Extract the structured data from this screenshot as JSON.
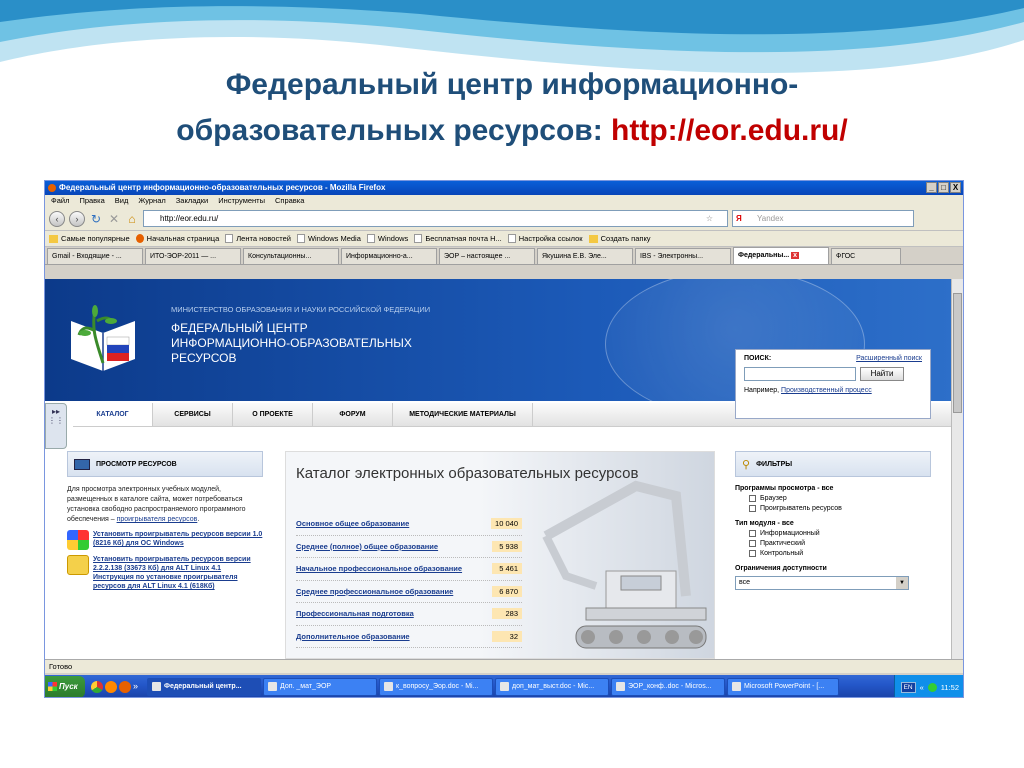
{
  "slide": {
    "title_line1": "Федеральный центр информационно-",
    "title_line2": "образовательных ресурсов: ",
    "title_url": "http://eor.edu.ru/"
  },
  "window": {
    "title": "Федеральный центр информационно-образовательных ресурсов - Mozilla Firefox",
    "controls": [
      "_",
      "□",
      "X"
    ]
  },
  "menubar": [
    "Файл",
    "Правка",
    "Вид",
    "Журнал",
    "Закладки",
    "Инструменты",
    "Справка"
  ],
  "navbar": {
    "url": "http://eor.edu.ru/",
    "search_engine": "Я",
    "search_placeholder": "Yandex"
  },
  "bookmarks": [
    {
      "label": "Самые популярные",
      "icon": "folder-icon"
    },
    {
      "label": "Начальная страница",
      "icon": "firefox-icon"
    },
    {
      "label": "Лента новостей",
      "icon": "page-icon"
    },
    {
      "label": "Windows Media",
      "icon": "page-icon"
    },
    {
      "label": "Windows",
      "icon": "page-icon"
    },
    {
      "label": "Бесплатная почта H...",
      "icon": "page-icon"
    },
    {
      "label": "Настройка ссылок",
      "icon": "page-icon"
    },
    {
      "label": "Создать папку",
      "icon": "folder-icon"
    }
  ],
  "tabs": [
    {
      "label": "Gmail - Входящие - ...",
      "active": false
    },
    {
      "label": "ИТО-ЭОР-2011 — ...",
      "active": false
    },
    {
      "label": "Консультационны...",
      "active": false
    },
    {
      "label": "Информационно-а...",
      "active": false
    },
    {
      "label": "ЭОР – настоящее ...",
      "active": false
    },
    {
      "label": "Якушина Е.В. Эле...",
      "active": false
    },
    {
      "label": "IBS - Электронны...",
      "active": false
    },
    {
      "label": "Федеральны...",
      "active": true
    },
    {
      "label": "ФГОС",
      "active": false
    }
  ],
  "site": {
    "ministry": "МИНИСТЕРСТВО ОБРАЗОВАНИЯ И НАУКИ РОССИЙСКОЙ ФЕДЕРАЦИИ",
    "org_line1": "ФЕДЕРАЛЬНЫЙ ЦЕНТР",
    "org_line2": "ИНФОРМАЦИОННО-ОБРАЗОВАТЕЛЬНЫХ",
    "org_line3": "РЕСУРСОВ",
    "menu": [
      "КАТАЛОГ",
      "СЕРВИСЫ",
      "О ПРОЕКТЕ",
      "ФОРУМ",
      "МЕТОДИЧЕСКИЕ МАТЕРИАЛЫ"
    ],
    "search": {
      "label": "ПОИСК:",
      "advanced": "Расширенный поиск",
      "button": "Найти",
      "example_prefix": "Например, ",
      "example_link": "Производственный процесс"
    },
    "viewer": {
      "title": "ПРОСМОТР РЕСУРСОВ",
      "text": "Для просмотра электронных учебных модулей, размещенных в каталоге сайта, может потребоваться установка свободно распространяемого программного обеспечения – ",
      "text_link": "проигрывателя ресурсов",
      "text_end": ".",
      "win_link": "Установить проигрыватель ресурсов версии 1.0 (8216 Кб) для ОС Windows",
      "alt_link": "Установить проигрыватель ресурсов версии 2.2.2.138 (33673 Кб) для ALT Linux 4.1",
      "alt_guide": "Инструкция по установке проигрывателя ресурсов для ALT Linux 4.1 (618Кб)"
    },
    "catalog": {
      "title": "Каталог электронных образовательных ресурсов",
      "rows": [
        {
          "label": "Основное общее образование",
          "count": "10 040"
        },
        {
          "label": "Среднее (полное) общее образование",
          "count": "5 938"
        },
        {
          "label": "Начальное профессиональное образование",
          "count": "5 461"
        },
        {
          "label": "Среднее профессиональное образование",
          "count": "6 870"
        },
        {
          "label": "Профессиональная подготовка",
          "count": "283"
        },
        {
          "label": "Дополнительное образование",
          "count": "32"
        }
      ]
    },
    "filters": {
      "title": "ФИЛЬТРЫ",
      "programs": "Программы просмотра - все",
      "program_opts": [
        "Браузер",
        "Проигрыватель ресурсов"
      ],
      "module_type": "Тип модуля - все",
      "module_opts": [
        "Информационный",
        "Практический",
        "Контрольный"
      ],
      "access": "Ограничения доступности",
      "access_value": "все"
    }
  },
  "status": "Готово",
  "taskbar": {
    "start": "Пуск",
    "items": [
      {
        "label": "Федеральный центр...",
        "active": true
      },
      {
        "label": "Доп. _мат_ЭОР",
        "active": false
      },
      {
        "label": "к_вопросу_Эор.doc - Mi...",
        "active": false
      },
      {
        "label": "доп_мат_выст.doc - Mic...",
        "active": false
      },
      {
        "label": "ЭОР_конф..doc - Micros...",
        "active": false
      },
      {
        "label": "Microsoft PowerPoint - [...",
        "active": false
      }
    ],
    "lang": "EN",
    "chevrons": "«",
    "time": "11:52"
  }
}
